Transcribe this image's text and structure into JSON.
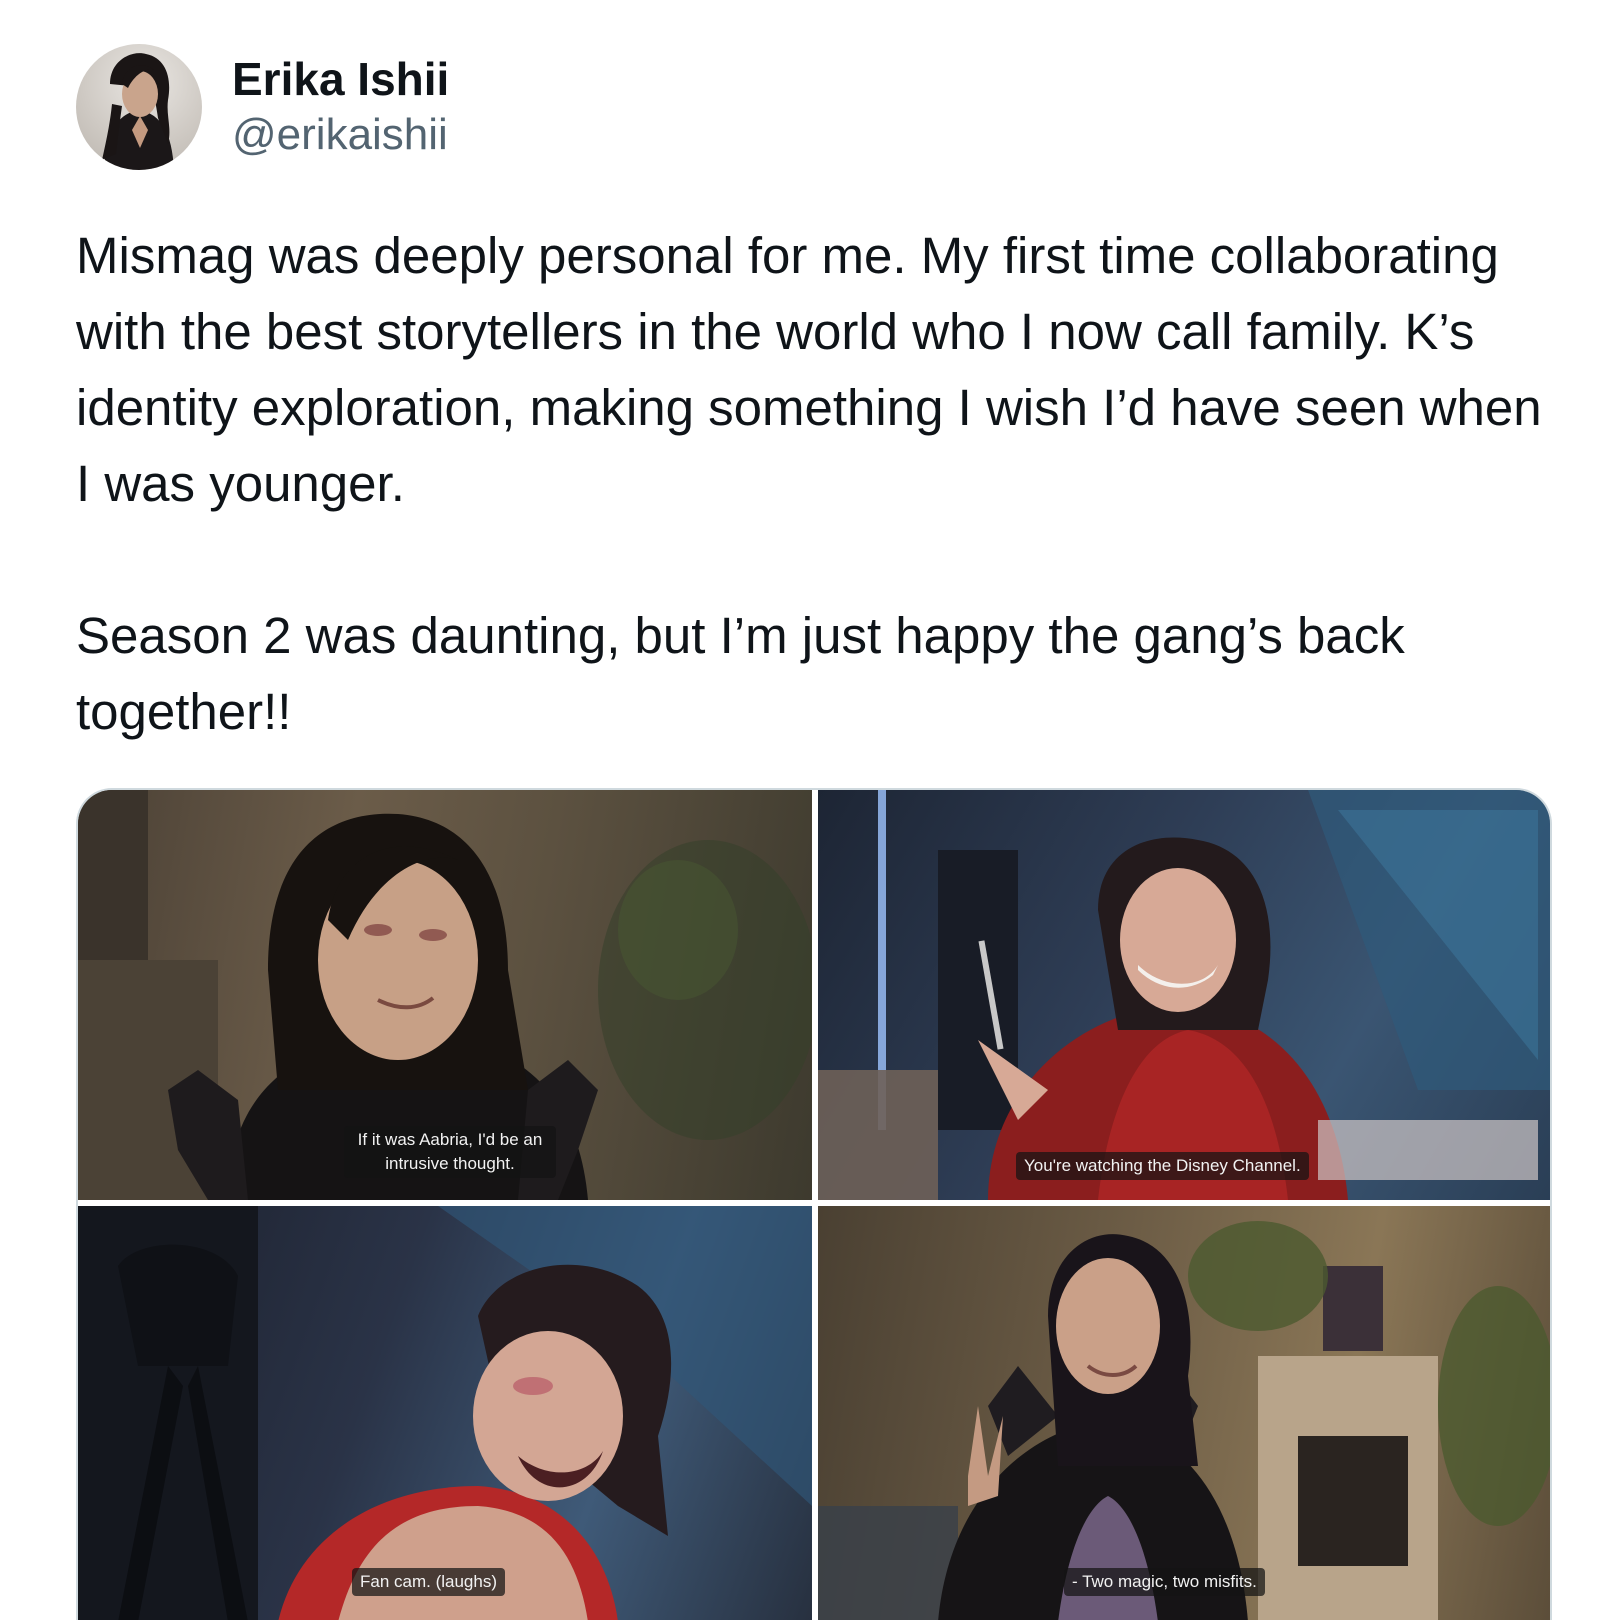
{
  "author": {
    "display_name": "Erika Ishii",
    "handle": "@erikaishii"
  },
  "tweet": {
    "paragraphs": [
      "Mismag was deeply personal for me. My first time collaborating with the best storytellers in the world who I now call family. K’s identity exploration, making something I wish I’d have seen when I was younger.",
      "Season 2 was daunting, but I’m just happy the gang’s back together!!"
    ]
  },
  "media": {
    "images": [
      {
        "caption": "If it was Aabria, I'd be an intrusive thought."
      },
      {
        "caption": "You're watching the Disney Channel."
      },
      {
        "caption": "Fan cam. (laughs)"
      },
      {
        "caption": "- Two magic, two misfits."
      }
    ]
  },
  "colors": {
    "text_primary": "#0f1419",
    "text_secondary": "#536471",
    "media_border": "#cfd9de"
  }
}
